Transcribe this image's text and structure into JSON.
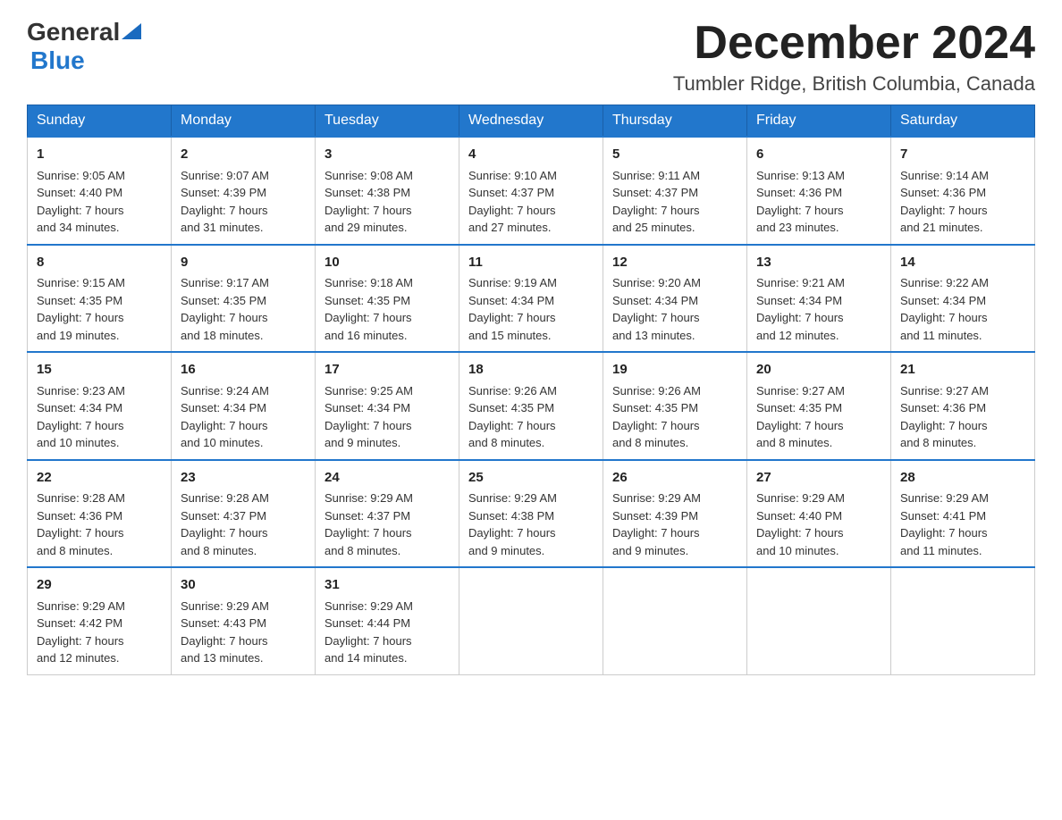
{
  "header": {
    "logo_general": "General",
    "logo_blue": "Blue",
    "month_title": "December 2024",
    "location": "Tumbler Ridge, British Columbia, Canada"
  },
  "weekdays": [
    "Sunday",
    "Monday",
    "Tuesday",
    "Wednesday",
    "Thursday",
    "Friday",
    "Saturday"
  ],
  "weeks": [
    [
      {
        "day": "1",
        "sunrise": "9:05 AM",
        "sunset": "4:40 PM",
        "daylight": "7 hours and 34 minutes."
      },
      {
        "day": "2",
        "sunrise": "9:07 AM",
        "sunset": "4:39 PM",
        "daylight": "7 hours and 31 minutes."
      },
      {
        "day": "3",
        "sunrise": "9:08 AM",
        "sunset": "4:38 PM",
        "daylight": "7 hours and 29 minutes."
      },
      {
        "day": "4",
        "sunrise": "9:10 AM",
        "sunset": "4:37 PM",
        "daylight": "7 hours and 27 minutes."
      },
      {
        "day": "5",
        "sunrise": "9:11 AM",
        "sunset": "4:37 PM",
        "daylight": "7 hours and 25 minutes."
      },
      {
        "day": "6",
        "sunrise": "9:13 AM",
        "sunset": "4:36 PM",
        "daylight": "7 hours and 23 minutes."
      },
      {
        "day": "7",
        "sunrise": "9:14 AM",
        "sunset": "4:36 PM",
        "daylight": "7 hours and 21 minutes."
      }
    ],
    [
      {
        "day": "8",
        "sunrise": "9:15 AM",
        "sunset": "4:35 PM",
        "daylight": "7 hours and 19 minutes."
      },
      {
        "day": "9",
        "sunrise": "9:17 AM",
        "sunset": "4:35 PM",
        "daylight": "7 hours and 18 minutes."
      },
      {
        "day": "10",
        "sunrise": "9:18 AM",
        "sunset": "4:35 PM",
        "daylight": "7 hours and 16 minutes."
      },
      {
        "day": "11",
        "sunrise": "9:19 AM",
        "sunset": "4:34 PM",
        "daylight": "7 hours and 15 minutes."
      },
      {
        "day": "12",
        "sunrise": "9:20 AM",
        "sunset": "4:34 PM",
        "daylight": "7 hours and 13 minutes."
      },
      {
        "day": "13",
        "sunrise": "9:21 AM",
        "sunset": "4:34 PM",
        "daylight": "7 hours and 12 minutes."
      },
      {
        "day": "14",
        "sunrise": "9:22 AM",
        "sunset": "4:34 PM",
        "daylight": "7 hours and 11 minutes."
      }
    ],
    [
      {
        "day": "15",
        "sunrise": "9:23 AM",
        "sunset": "4:34 PM",
        "daylight": "7 hours and 10 minutes."
      },
      {
        "day": "16",
        "sunrise": "9:24 AM",
        "sunset": "4:34 PM",
        "daylight": "7 hours and 10 minutes."
      },
      {
        "day": "17",
        "sunrise": "9:25 AM",
        "sunset": "4:34 PM",
        "daylight": "7 hours and 9 minutes."
      },
      {
        "day": "18",
        "sunrise": "9:26 AM",
        "sunset": "4:35 PM",
        "daylight": "7 hours and 8 minutes."
      },
      {
        "day": "19",
        "sunrise": "9:26 AM",
        "sunset": "4:35 PM",
        "daylight": "7 hours and 8 minutes."
      },
      {
        "day": "20",
        "sunrise": "9:27 AM",
        "sunset": "4:35 PM",
        "daylight": "7 hours and 8 minutes."
      },
      {
        "day": "21",
        "sunrise": "9:27 AM",
        "sunset": "4:36 PM",
        "daylight": "7 hours and 8 minutes."
      }
    ],
    [
      {
        "day": "22",
        "sunrise": "9:28 AM",
        "sunset": "4:36 PM",
        "daylight": "7 hours and 8 minutes."
      },
      {
        "day": "23",
        "sunrise": "9:28 AM",
        "sunset": "4:37 PM",
        "daylight": "7 hours and 8 minutes."
      },
      {
        "day": "24",
        "sunrise": "9:29 AM",
        "sunset": "4:37 PM",
        "daylight": "7 hours and 8 minutes."
      },
      {
        "day": "25",
        "sunrise": "9:29 AM",
        "sunset": "4:38 PM",
        "daylight": "7 hours and 9 minutes."
      },
      {
        "day": "26",
        "sunrise": "9:29 AM",
        "sunset": "4:39 PM",
        "daylight": "7 hours and 9 minutes."
      },
      {
        "day": "27",
        "sunrise": "9:29 AM",
        "sunset": "4:40 PM",
        "daylight": "7 hours and 10 minutes."
      },
      {
        "day": "28",
        "sunrise": "9:29 AM",
        "sunset": "4:41 PM",
        "daylight": "7 hours and 11 minutes."
      }
    ],
    [
      {
        "day": "29",
        "sunrise": "9:29 AM",
        "sunset": "4:42 PM",
        "daylight": "7 hours and 12 minutes."
      },
      {
        "day": "30",
        "sunrise": "9:29 AM",
        "sunset": "4:43 PM",
        "daylight": "7 hours and 13 minutes."
      },
      {
        "day": "31",
        "sunrise": "9:29 AM",
        "sunset": "4:44 PM",
        "daylight": "7 hours and 14 minutes."
      },
      null,
      null,
      null,
      null
    ]
  ],
  "labels": {
    "sunrise": "Sunrise:",
    "sunset": "Sunset:",
    "daylight": "Daylight:"
  }
}
